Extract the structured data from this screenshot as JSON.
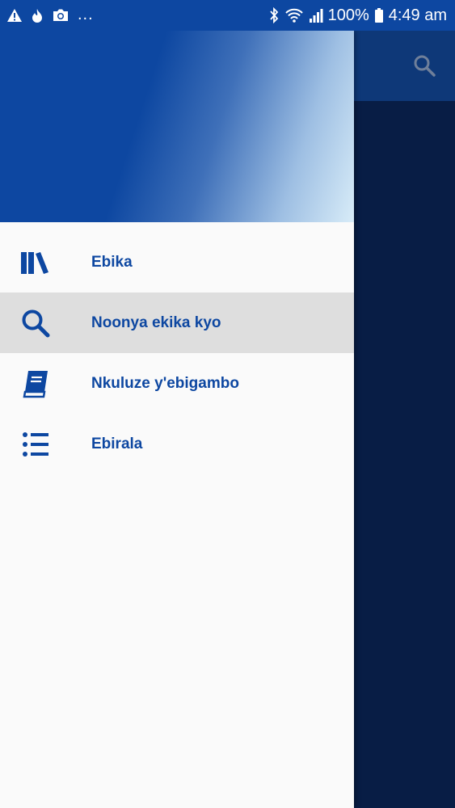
{
  "status_bar": {
    "overflow": "...",
    "battery": "100%",
    "time": "4:49 am",
    "left_icons": [
      "warning-icon",
      "flame-icon",
      "camera-icon"
    ],
    "right_icons": [
      "bluetooth-icon",
      "wifi-icon",
      "signal-icon",
      "battery-icon"
    ]
  },
  "app_bar": {
    "search_icon": "search-icon"
  },
  "drawer": {
    "items": [
      {
        "label": "Ebika",
        "icon": "books-icon",
        "selected": false
      },
      {
        "label": "Noonya ekika kyo",
        "icon": "search-icon",
        "selected": true
      },
      {
        "label": "Nkuluze y'ebigambo",
        "icon": "book-icon",
        "selected": false
      },
      {
        "label": "Ebirala",
        "icon": "list-icon",
        "selected": false
      }
    ]
  },
  "colors": {
    "primary": "#0d47a1",
    "status_bar": "#0d47a1",
    "app_toolbar": "#0e3878",
    "app_background": "#081d45",
    "drawer_background": "#fafafa",
    "selected_item": "#dedede"
  }
}
